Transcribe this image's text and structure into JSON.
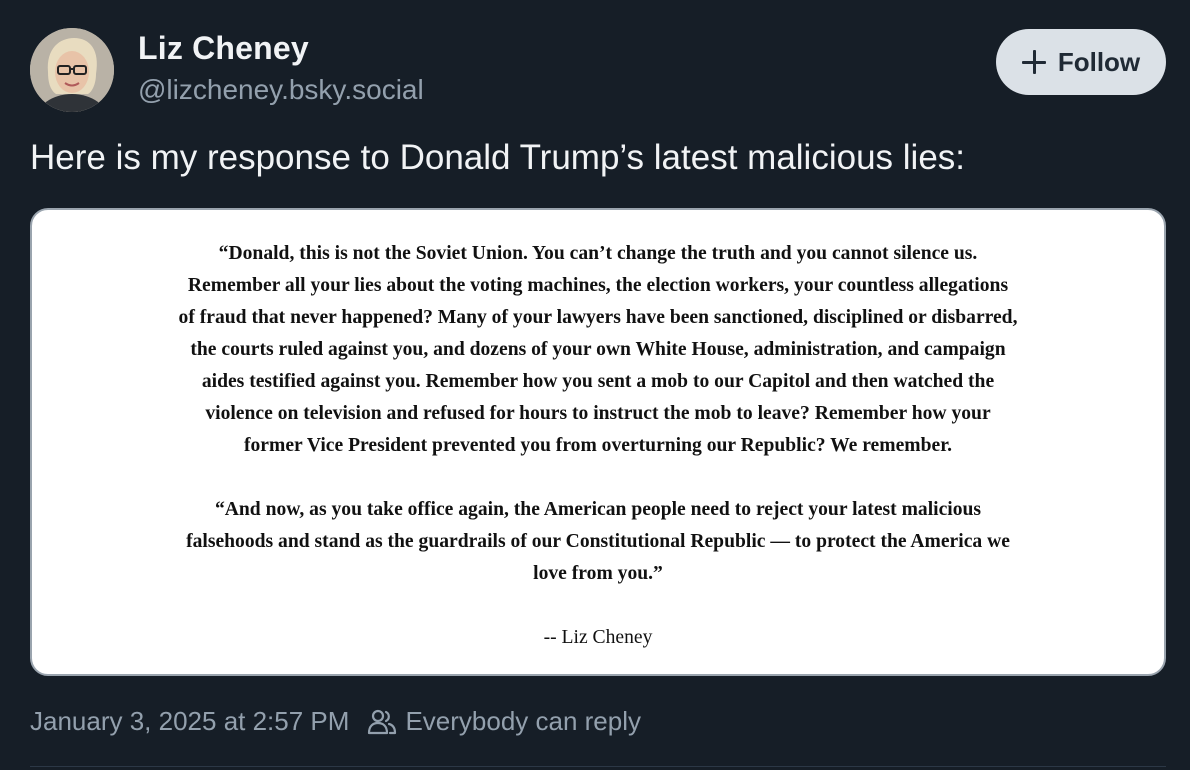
{
  "author": {
    "name": "Liz Cheney",
    "handle": "@lizcheney.bsky.social",
    "avatar_icon": "profile-photo"
  },
  "follow_button": {
    "label": "Follow",
    "icon": "plus-icon"
  },
  "post": {
    "text": "Here is my response to Donald Trump’s latest malicious lies:",
    "image": {
      "paragraph1_lines": [
        "“Donald, this is not the Soviet Union. You can’t change the truth and you cannot silence us.",
        "Remember all your lies about the voting machines, the election workers, your countless allegations",
        "of fraud that never happened? Many of your lawyers have been sanctioned, disciplined or disbarred,",
        "the courts ruled against you, and dozens of your own White House, administration, and campaign",
        "aides testified against you. Remember how you sent a mob to our Capitol and then watched the",
        "violence on television and refused for hours to instruct the mob to leave? Remember how your",
        "former Vice President prevented you from overturning our Republic? We remember."
      ],
      "paragraph2_lines": [
        "“And now, as you take office again, the American people need to reject your latest malicious",
        "falsehoods and stand as the guardrails of our Constitutional Republic — to protect the America we",
        "love from you.”"
      ],
      "signature": "-- Liz Cheney"
    },
    "timestamp": "January 3, 2025 at 2:57 PM",
    "reply_setting": "Everybody can reply",
    "reply_icon": "people-icon"
  },
  "colors": {
    "background": "#161e27",
    "secondary_text": "#93a0ad",
    "follow_bg": "#dbe1e7"
  }
}
